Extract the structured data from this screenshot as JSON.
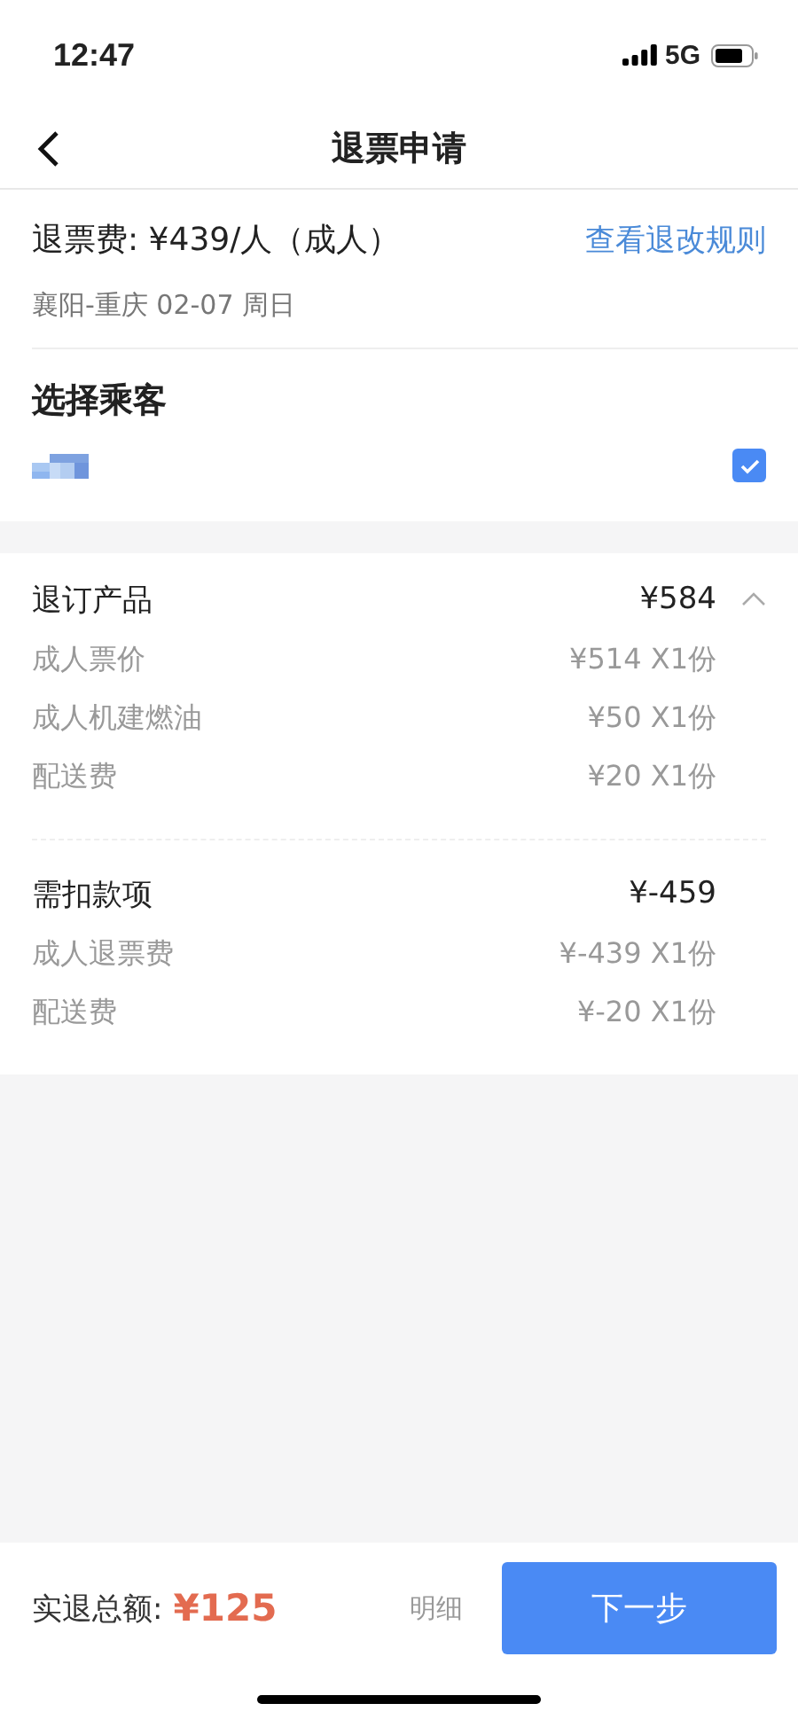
{
  "status_bar": {
    "time": "12:47",
    "network": "5G"
  },
  "nav": {
    "title": "退票申请"
  },
  "ticket": {
    "fee": "退票费: ¥439/人（成人）",
    "rules_link": "查看退改规则",
    "route": "襄阳-重庆 02-07 周日"
  },
  "passengers": {
    "title": "选择乘客",
    "items": [
      {
        "checked": true
      }
    ]
  },
  "fee_groups": [
    {
      "title": "退订产品",
      "total": "¥584",
      "expanded": true,
      "items": [
        {
          "label": "成人票价",
          "amount": "¥514 X1份"
        },
        {
          "label": "成人机建燃油",
          "amount": "¥50 X1份"
        },
        {
          "label": "配送费",
          "amount": "¥20 X1份"
        }
      ]
    },
    {
      "title": "需扣款项",
      "total": "¥-459",
      "items": [
        {
          "label": "成人退票费",
          "amount": "¥-439 X1份"
        },
        {
          "label": "配送费",
          "amount": "¥-20 X1份"
        }
      ]
    }
  ],
  "bottom_bar": {
    "total_label": "实退总额:",
    "total": "¥125",
    "details_link": "明细",
    "next_button": "下一步"
  }
}
